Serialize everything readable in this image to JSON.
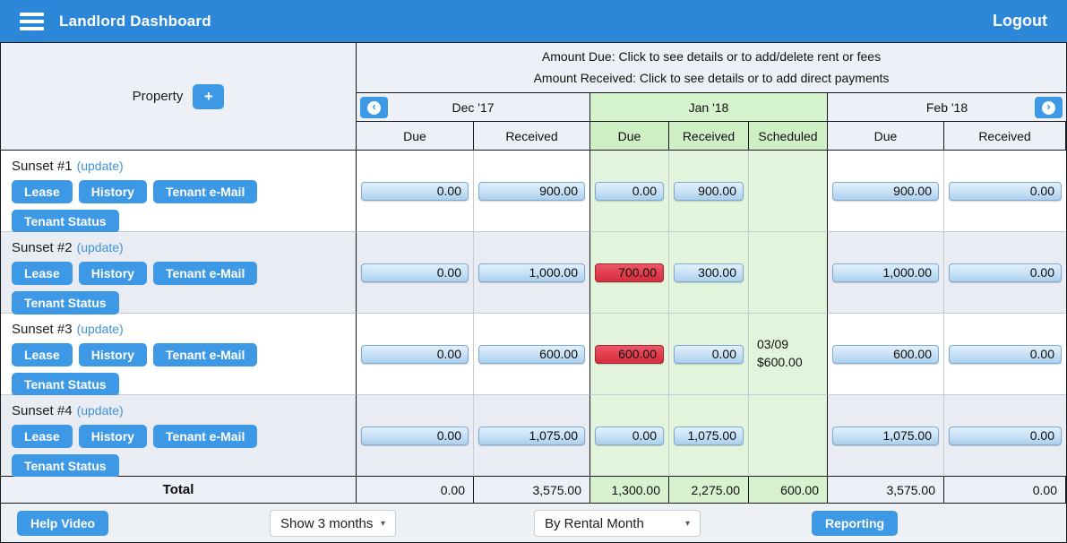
{
  "colors": {
    "header_blue": "#2c87d8",
    "button_blue": "#3d99e5",
    "overdue_red": "#e23e4e",
    "month_highlight_green": "#d5f3cc"
  },
  "icons": {
    "menu": "hamburger-icon",
    "prev_glyph": "‹",
    "next_glyph": "›",
    "caret_glyph": "▾",
    "plus_glyph": "+"
  },
  "header": {
    "title": "Landlord Dashboard",
    "logout": "Logout"
  },
  "table": {
    "property_label": "Property",
    "instructions_line1": "Amount Due: Click to see details or to add/delete rent or fees",
    "instructions_line2": "Amount Received: Click to see details or to add direct payments",
    "months": [
      {
        "label": "Dec '17"
      },
      {
        "label": "Jan '18"
      },
      {
        "label": "Feb '18"
      }
    ],
    "columns": {
      "due": "Due",
      "received": "Received",
      "scheduled": "Scheduled"
    },
    "rows": [
      {
        "name": "Sunset #1",
        "update": "(update)",
        "buttons": [
          "Lease",
          "History",
          "Tenant e-Mail",
          "Tenant Status"
        ],
        "dec_due": "0.00",
        "dec_received": "900.00",
        "jan_due": "0.00",
        "jan_due_variant": "",
        "jan_received": "900.00",
        "scheduled_date": "",
        "scheduled_amount": "",
        "feb_due": "900.00",
        "feb_received": "0.00"
      },
      {
        "name": "Sunset #2",
        "update": "(update)",
        "buttons": [
          "Lease",
          "History",
          "Tenant e-Mail",
          "Tenant Status"
        ],
        "dec_due": "0.00",
        "dec_received": "1,000.00",
        "jan_due": "700.00",
        "jan_due_variant": "overdue",
        "jan_received": "300.00",
        "scheduled_date": "",
        "scheduled_amount": "",
        "feb_due": "1,000.00",
        "feb_received": "0.00"
      },
      {
        "name": "Sunset #3",
        "update": "(update)",
        "buttons": [
          "Lease",
          "History",
          "Tenant e-Mail",
          "Tenant Status"
        ],
        "dec_due": "0.00",
        "dec_received": "600.00",
        "jan_due": "600.00",
        "jan_due_variant": "overdue",
        "jan_received": "0.00",
        "scheduled_date": "03/09",
        "scheduled_amount": "$600.00",
        "feb_due": "600.00",
        "feb_received": "0.00"
      },
      {
        "name": "Sunset #4",
        "update": "(update)",
        "buttons": [
          "Lease",
          "History",
          "Tenant e-Mail",
          "Tenant Status"
        ],
        "dec_due": "0.00",
        "dec_received": "1,075.00",
        "jan_due": "0.00",
        "jan_due_variant": "",
        "jan_received": "1,075.00",
        "scheduled_date": "",
        "scheduled_amount": "",
        "feb_due": "1,075.00",
        "feb_received": "0.00"
      }
    ],
    "total": {
      "label": "Total",
      "dec_due": "0.00",
      "dec_received": "3,575.00",
      "jan_due": "1,300.00",
      "jan_received": "2,275.00",
      "scheduled": "600.00",
      "feb_due": "3,575.00",
      "feb_received": "0.00"
    }
  },
  "footer": {
    "help_video": "Help Video",
    "show_months": "Show 3 months",
    "by_rental_month": "By Rental Month",
    "reporting": "Reporting"
  }
}
